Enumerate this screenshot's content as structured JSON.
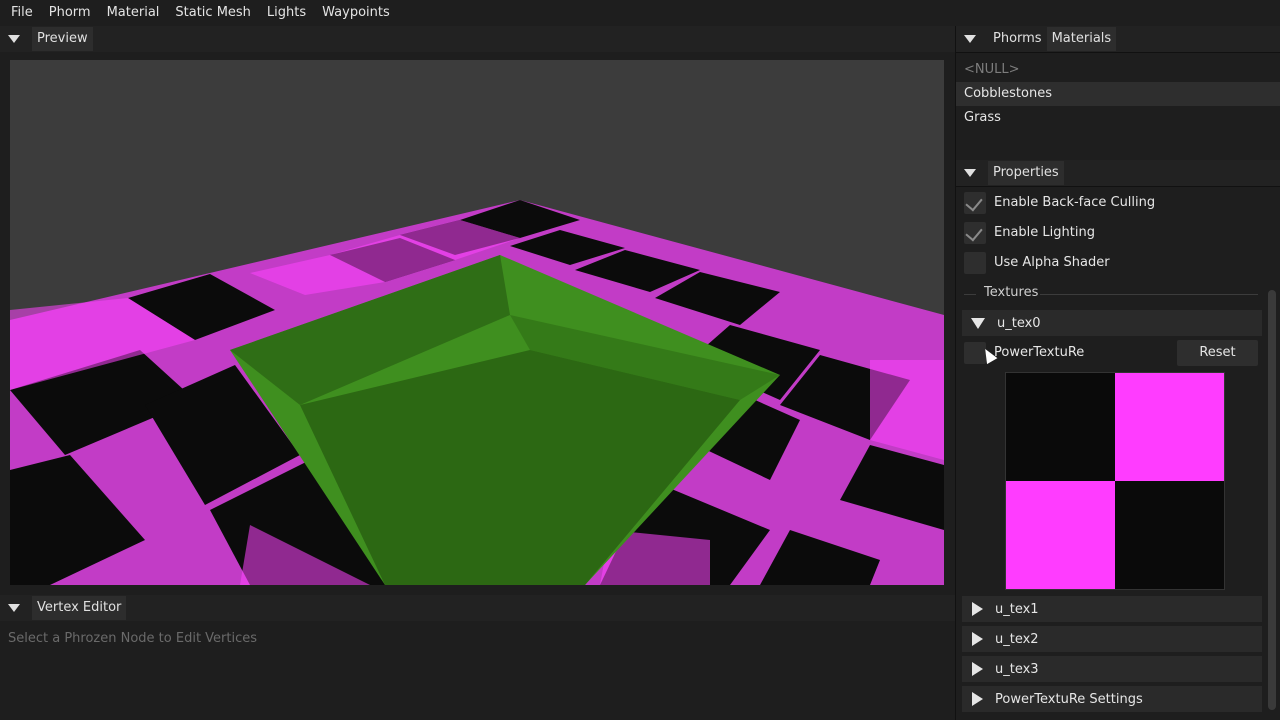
{
  "menubar": {
    "items": [
      "File",
      "Phorm",
      "Material",
      "Static Mesh",
      "Lights",
      "Waypoints"
    ]
  },
  "preview_panel": {
    "title": "Preview"
  },
  "vertex_editor": {
    "title": "Vertex Editor",
    "hint": "Select a Phrozen Node to Edit Vertices"
  },
  "top_right_panel": {
    "tabs": [
      "Phorms",
      "Materials"
    ],
    "active_tab": "Materials",
    "materials": [
      "<NULL>",
      "Cobblestones",
      "Grass"
    ],
    "selected_material": "Cobblestones"
  },
  "properties_panel": {
    "title": "Properties",
    "checkboxes": [
      {
        "label": "Enable Back-face Culling",
        "checked": true
      },
      {
        "label": "Enable Lighting",
        "checked": true
      },
      {
        "label": "Use Alpha Shader",
        "checked": false
      }
    ],
    "textures_label": "Textures",
    "texture_slots": [
      "u_tex0",
      "u_tex1",
      "u_tex2",
      "u_tex3",
      "PowerTextuRe Settings"
    ],
    "expanded_slot": "u_tex0",
    "texture_name": "PowerTextuRe",
    "reset_label": "Reset"
  },
  "colors": {
    "checker_magenta": "#ff3cff",
    "checker_black": "#0a0a0a",
    "grass_green": "#3c8a1c"
  }
}
